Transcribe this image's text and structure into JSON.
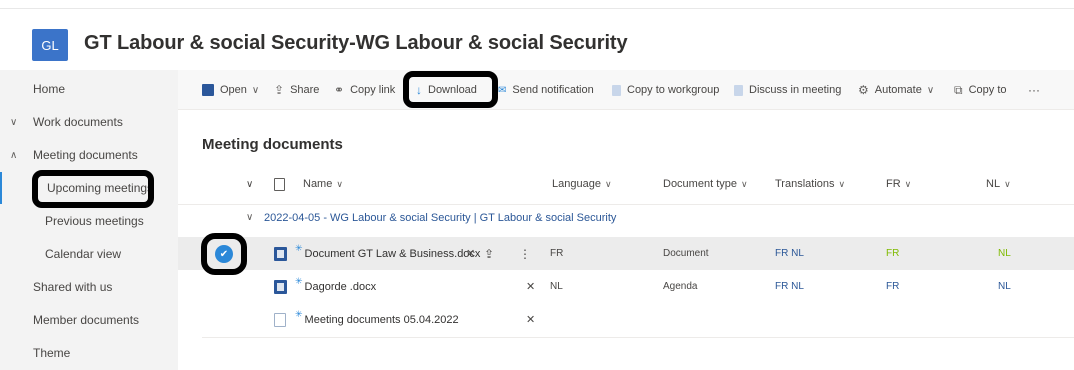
{
  "site": {
    "logo_text": "GL",
    "title": "GT Labour & social Security-WG Labour & social Security"
  },
  "sidebar": {
    "items": [
      {
        "label": "Home",
        "chevron": ""
      },
      {
        "label": "Work documents",
        "chevron": "∨"
      },
      {
        "label": "Meeting documents",
        "chevron": "∧"
      },
      {
        "label": "Upcoming meetings",
        "chevron": ""
      },
      {
        "label": "Previous meetings",
        "chevron": ""
      },
      {
        "label": "Calendar view",
        "chevron": ""
      },
      {
        "label": "Shared with us",
        "chevron": ""
      },
      {
        "label": "Member documents",
        "chevron": ""
      },
      {
        "label": "Theme",
        "chevron": ""
      }
    ]
  },
  "toolbar": {
    "open": "Open",
    "share": "Share",
    "copy_link": "Copy link",
    "download": "Download",
    "send_notification": "Send notification",
    "copy_to_workgroup": "Copy to workgroup",
    "discuss_in_meeting": "Discuss in meeting",
    "automate": "Automate",
    "copy_to": "Copy to",
    "more": "···"
  },
  "main": {
    "title": "Meeting documents",
    "columns": {
      "name": "Name",
      "language": "Language",
      "document_type": "Document type",
      "translations": "Translations",
      "fr": "FR",
      "nl": "NL"
    },
    "group": {
      "label": "2022-04-05 - WG Labour & social Security | GT Labour & social Security"
    },
    "rows": [
      {
        "name": "Document GT Law & Business.docx",
        "language": "FR",
        "type": "Document",
        "translations": "FR NL",
        "fr": "FR",
        "nl": "NL"
      },
      {
        "name": "Dagorde .docx",
        "language": "NL",
        "type": "Agenda",
        "translations": "FR NL",
        "fr": "FR",
        "nl": "NL"
      },
      {
        "name": "Meeting documents 05.04.2022",
        "language": "",
        "type": "",
        "translations": "",
        "fr": "",
        "nl": ""
      }
    ]
  },
  "icons": {
    "chevron_down": "∨",
    "chevron_up": "∧",
    "share": "⇪",
    "link": "⚭",
    "download": "↓",
    "check": "✔",
    "pin": "✕",
    "more_vertical": "⋮",
    "file": "🗋"
  }
}
